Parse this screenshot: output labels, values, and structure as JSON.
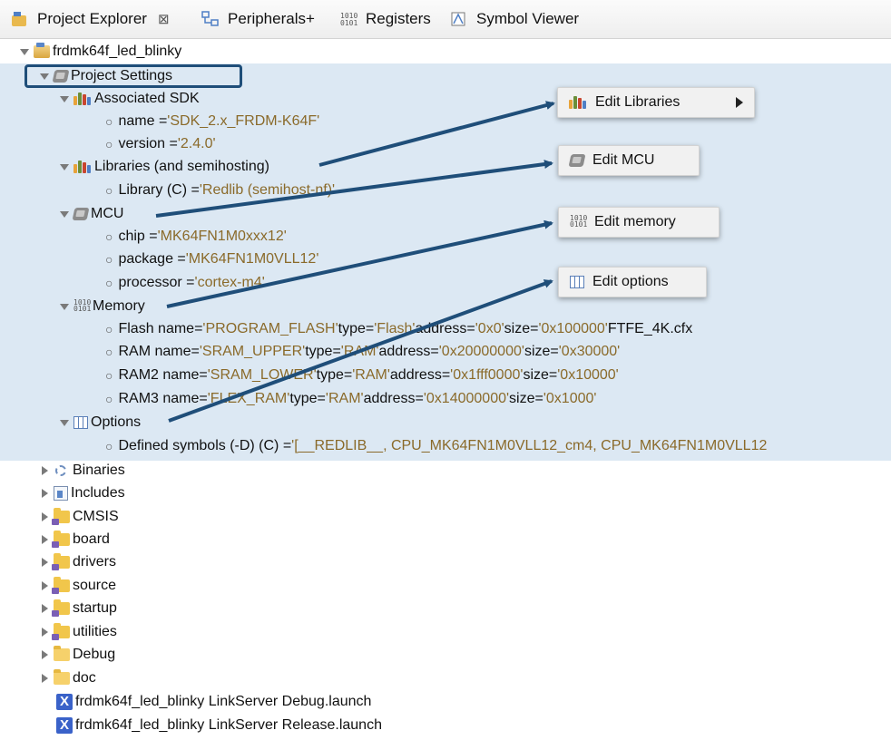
{
  "tabs": [
    {
      "label": "Project Explorer",
      "icon": "project-explorer-icon",
      "close": "⊠"
    },
    {
      "label": "Peripherals+",
      "icon": "peripherals-icon"
    },
    {
      "label": "Registers",
      "icon": "registers-icon"
    },
    {
      "label": "Symbol Viewer",
      "icon": "symbol-viewer-icon"
    }
  ],
  "tree": {
    "project": "frdmk64f_led_blinky",
    "project_settings": "Project Settings",
    "sdk": {
      "label": "Associated SDK",
      "name_key": "name = ",
      "name_val": "'SDK_2.x_FRDM-K64F'",
      "version_key": "version = ",
      "version_val": "'2.4.0'"
    },
    "libraries": {
      "label": "Libraries (and semihosting)",
      "lib_key": "Library (C) = ",
      "lib_val": "'Redlib (semihost-nf)'"
    },
    "mcu": {
      "label": "MCU",
      "chip_key": "chip = ",
      "chip_val": "'MK64FN1M0xxx12'",
      "package_key": "package = ",
      "package_val": "'MK64FN1M0VLL12'",
      "processor_key": "processor = ",
      "processor_val": "'cortex-m4'"
    },
    "memory": {
      "label": "Memory",
      "flash": {
        "a": "Flash name=",
        "b": "'PROGRAM_FLASH'",
        "c": " type=",
        "d": "'Flash'",
        "e": " address=",
        "f": "'0x0'",
        "g": " size=",
        "h": "'0x100000'",
        "i": " FTFE_4K.cfx"
      },
      "ram": {
        "a": "RAM name=",
        "b": "'SRAM_UPPER'",
        "c": " type=",
        "d": "'RAM'",
        "e": " address=",
        "f": "'0x20000000'",
        "g": " size=",
        "h": "'0x30000'"
      },
      "ram2": {
        "a": "RAM2 name=",
        "b": "'SRAM_LOWER'",
        "c": " type=",
        "d": "'RAM'",
        "e": " address=",
        "f": "'0x1fff0000'",
        "g": " size=",
        "h": "'0x10000'"
      },
      "ram3": {
        "a": "RAM3 name=",
        "b": "'FLEX_RAM'",
        "c": " type=",
        "d": "'RAM'",
        "e": " address=",
        "f": "'0x14000000'",
        "g": " size=",
        "h": "'0x1000'"
      }
    },
    "options": {
      "label": "Options",
      "defined_key": "Defined symbols (-D) (C) = ",
      "defined_val": "'[__REDLIB__, CPU_MK64FN1M0VLL12_cm4, CPU_MK64FN1M0VLL12"
    },
    "folders": [
      "Binaries",
      "Includes",
      "CMSIS",
      "board",
      "drivers",
      "source",
      "startup",
      "utilities",
      "Debug",
      "doc"
    ],
    "launch_files": [
      "frdmk64f_led_blinky LinkServer Debug.launch",
      "frdmk64f_led_blinky LinkServer Release.launch"
    ]
  },
  "popups": {
    "edit_libraries": "Edit Libraries",
    "edit_mcu": "Edit MCU",
    "edit_memory": "Edit memory",
    "edit_options": "Edit options"
  },
  "colors": {
    "selection_bg": "#dce8f3",
    "string_value": "#8a6a2a",
    "arrow": "#1f4e79"
  }
}
